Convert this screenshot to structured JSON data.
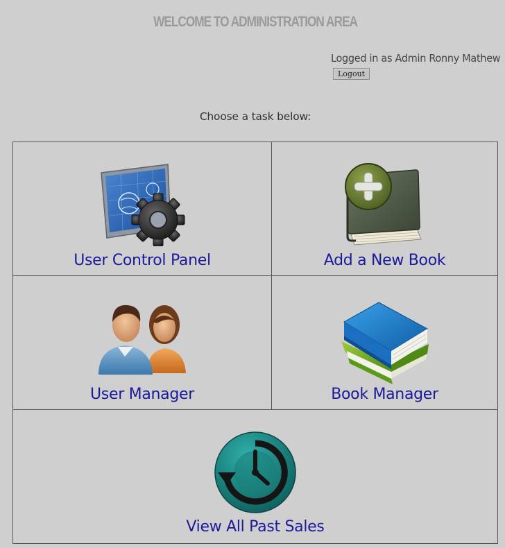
{
  "header": {
    "title": "WELCOME TO ADMINISTRATION AREA",
    "logged_in_text": "Logged in as Admin Ronny Mathew",
    "logout_label": "Logout"
  },
  "prompt": "Choose a task below:",
  "tasks": [
    {
      "label": "User Control Panel",
      "icon": "blueprint-gear-icon"
    },
    {
      "label": "Add a New Book",
      "icon": "book-add-icon"
    },
    {
      "label": "User Manager",
      "icon": "users-icon"
    },
    {
      "label": "Book Manager",
      "icon": "books-icon"
    },
    {
      "label": "View All Past Sales",
      "icon": "history-clock-icon"
    }
  ],
  "colors": {
    "background": "#cfcfcf",
    "link": "#1a1a9a",
    "title": "#9a9a9a"
  }
}
